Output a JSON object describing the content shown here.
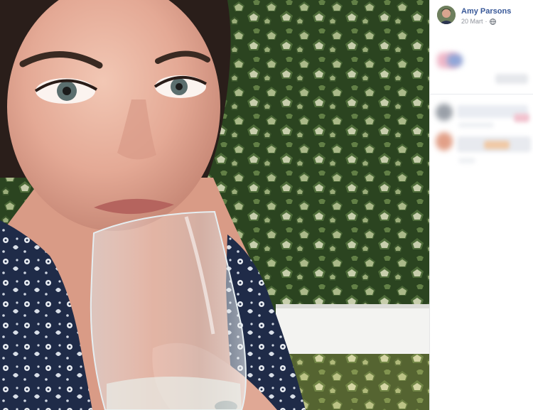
{
  "post": {
    "author_name": "Amy Parsons",
    "date": "20 Mart",
    "separator": "·",
    "audience_icon": "globe-icon"
  },
  "photo": {
    "subject": "selfie-wine-glass",
    "background": "ivy-wall"
  },
  "colors": {
    "author_link": "#385898",
    "meta_text": "#90949c",
    "panel_bg": "#ffffff",
    "ivy_dark": "#2f4a23",
    "ivy_light": "#c9d6a8"
  }
}
